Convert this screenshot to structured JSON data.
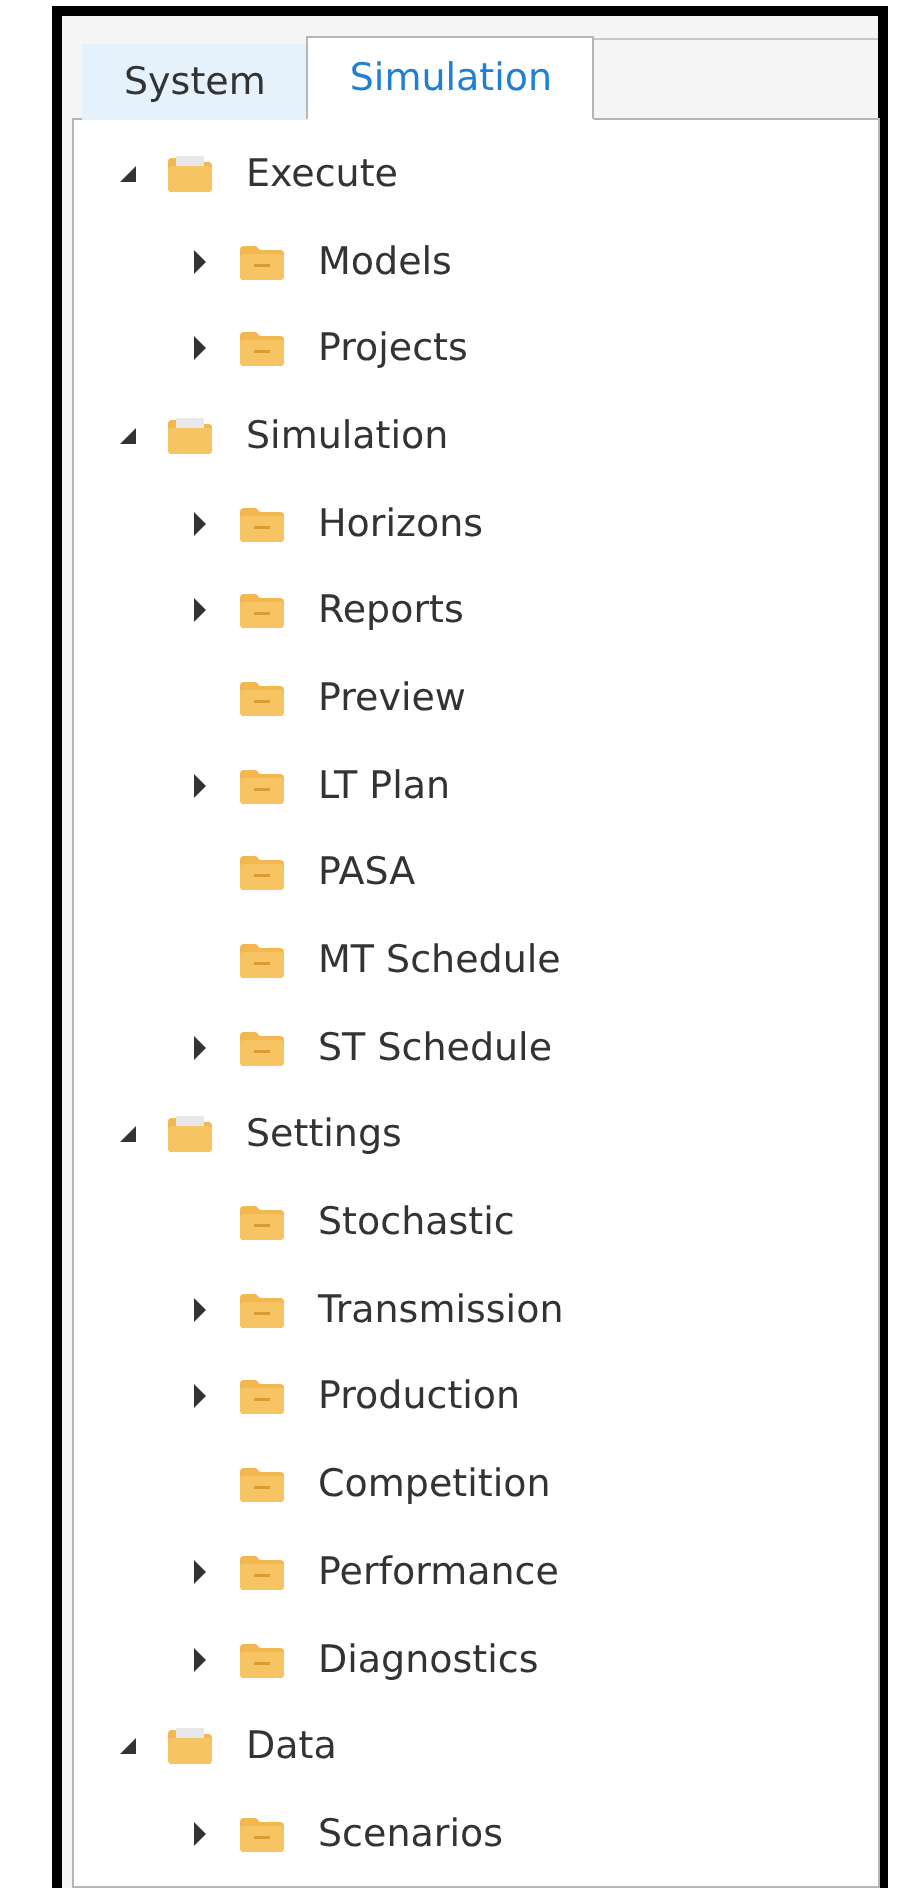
{
  "tabs": [
    {
      "label": "System",
      "selected": false
    },
    {
      "label": "Simulation",
      "selected": true
    }
  ],
  "tree": [
    {
      "label": "Execute",
      "expanded": true,
      "children": [
        {
          "label": "Models",
          "expanded": false
        },
        {
          "label": "Projects",
          "expanded": false
        }
      ]
    },
    {
      "label": "Simulation",
      "expanded": true,
      "children": [
        {
          "label": "Horizons",
          "expanded": false
        },
        {
          "label": "Reports",
          "expanded": false
        },
        {
          "label": "Preview"
        },
        {
          "label": "LT Plan",
          "expanded": false
        },
        {
          "label": "PASA"
        },
        {
          "label": "MT Schedule"
        },
        {
          "label": "ST Schedule",
          "expanded": false
        }
      ]
    },
    {
      "label": "Settings",
      "expanded": true,
      "children": [
        {
          "label": "Stochastic"
        },
        {
          "label": "Transmission",
          "expanded": false
        },
        {
          "label": "Production",
          "expanded": false
        },
        {
          "label": "Competition"
        },
        {
          "label": "Performance",
          "expanded": false
        },
        {
          "label": "Diagnostics",
          "expanded": false
        }
      ]
    },
    {
      "label": "Data",
      "expanded": true,
      "children": [
        {
          "label": "Scenarios",
          "expanded": false
        }
      ]
    }
  ]
}
